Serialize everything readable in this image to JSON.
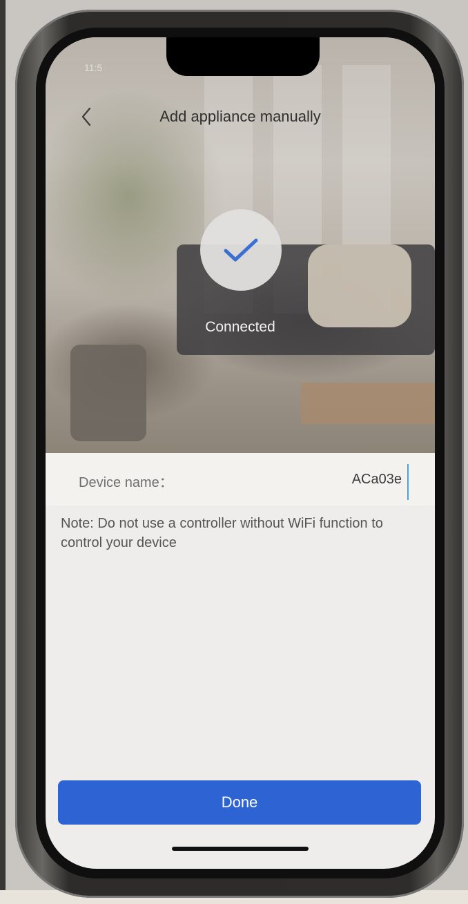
{
  "status_bar": {
    "time": "11:5"
  },
  "header": {
    "title": "Add appliance manually"
  },
  "status": {
    "text": "Connected"
  },
  "device_name": {
    "label": "Device name：",
    "value": "ACa03e"
  },
  "note": {
    "text": "Note: Do not use a controller without WiFi function to control your device"
  },
  "actions": {
    "done_label": "Done"
  },
  "colors": {
    "primary": "#2d63d3",
    "check": "#3b6fd1",
    "cursor": "#4aa3e0"
  },
  "icons": {
    "back": "chevron-left-icon",
    "check": "checkmark-icon"
  }
}
